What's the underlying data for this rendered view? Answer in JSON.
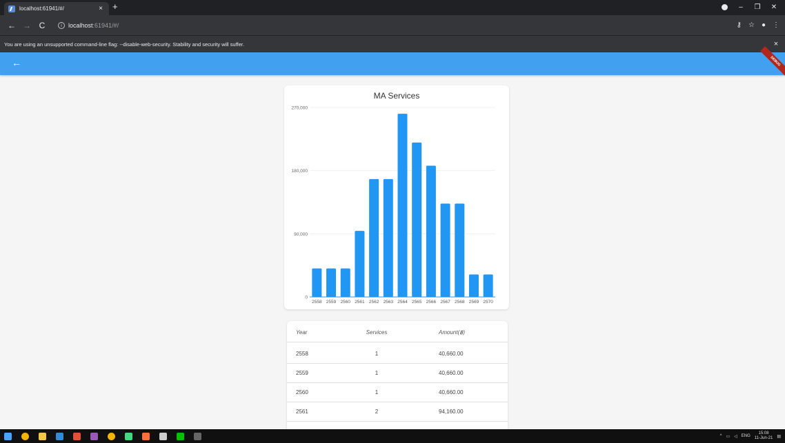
{
  "browser": {
    "tab_title": "localhost:61941/#/",
    "tab_close": "×",
    "new_tab": "+",
    "url_host": "localhost",
    "url_rest": ":61941/#/",
    "info_icon": "ⓘ",
    "infobar_message": "You are using an unsupported command-line flag: --disable-web-security. Stability and security will suffer.",
    "infobar_close": "×"
  },
  "appbar": {
    "back_icon": "←",
    "debug_banner": "DEBUG"
  },
  "chart_data": {
    "type": "bar",
    "title": "MA Services",
    "categories": [
      "2558",
      "2559",
      "2560",
      "2561",
      "2562",
      "2563",
      "2564",
      "2565",
      "2566",
      "2567",
      "2568",
      "2569",
      "2570"
    ],
    "values": [
      40660,
      40660,
      40660,
      94160,
      168000,
      168000,
      261000,
      220000,
      187000,
      133000,
      133000,
      32000,
      32000
    ],
    "ylim": [
      0,
      270000
    ],
    "yticks": [
      0,
      90000,
      180000,
      270000
    ],
    "ytick_labels": [
      "0",
      "90,000",
      "180,000",
      "270,000"
    ],
    "grid": true,
    "bar_color": "#2196f3"
  },
  "table": {
    "headers": {
      "year": "Year",
      "services": "Services",
      "amount": "Amount(฿)"
    },
    "rows": [
      {
        "year": "2558",
        "services": "1",
        "amount": "40,660.00"
      },
      {
        "year": "2559",
        "services": "1",
        "amount": "40,660.00"
      },
      {
        "year": "2560",
        "services": "1",
        "amount": "40,660.00"
      },
      {
        "year": "2561",
        "services": "2",
        "amount": "94,160.00"
      }
    ]
  },
  "taskbar": {
    "icons": [
      "windows-start-icon",
      "chrome-icon",
      "file-explorer-icon",
      "vscode-icon",
      "git-icon",
      "app-icon",
      "chrome-icon",
      "android-studio-icon",
      "app-icon",
      "github-icon",
      "line-icon",
      "terminal-icon"
    ],
    "icon_colors": [
      "#4aa3ff",
      "#f4b400",
      "#f2c744",
      "#2f8dd7",
      "#e24f3b",
      "#9b59b6",
      "#f4b400",
      "#3ddc84",
      "#ff6f3c",
      "#cccccc",
      "#00c300",
      "#666666"
    ],
    "language": "ENG",
    "time": "15:08",
    "date": "11-Jun-21"
  }
}
